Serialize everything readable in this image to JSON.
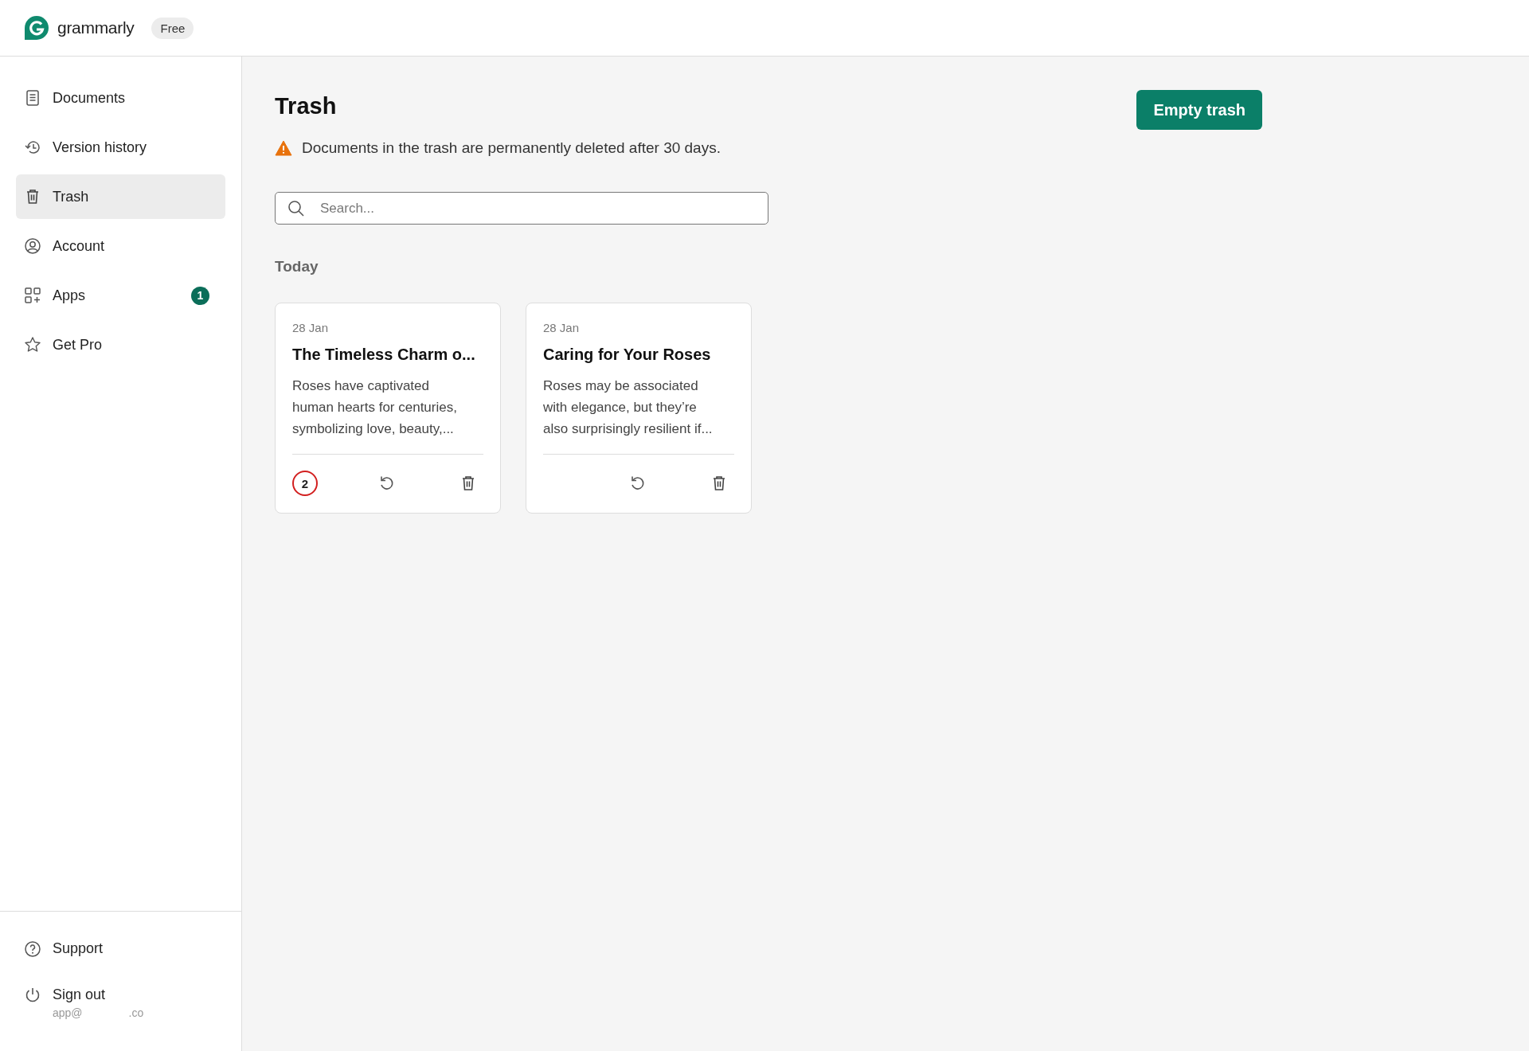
{
  "header": {
    "logo_text": "grammarly",
    "plan_badge": "Free"
  },
  "sidebar": {
    "items": [
      {
        "kind": "documents",
        "label": "Documents",
        "selected": false
      },
      {
        "kind": "history",
        "label": "Version history",
        "selected": false
      },
      {
        "kind": "trash",
        "label": "Trash",
        "selected": true
      },
      {
        "kind": "account",
        "label": "Account",
        "selected": false
      },
      {
        "kind": "apps",
        "label": "Apps",
        "selected": false,
        "badge": "1"
      },
      {
        "kind": "star",
        "label": "Get Pro",
        "selected": false
      }
    ],
    "bottom_items": [
      {
        "kind": "support",
        "label": "Support"
      },
      {
        "kind": "power",
        "label": "Sign out",
        "email_start": "app@",
        "email_end": ".co"
      }
    ]
  },
  "main": {
    "title": "Trash",
    "empty_button": "Empty trash",
    "notice": "Documents in the trash are permanently deleted after 30 days.",
    "search": {
      "placeholder": "Search..."
    },
    "group_label": "Today",
    "cards": [
      {
        "date": "28 Jan",
        "title": "The Timeless Charm o...",
        "excerpt": "Roses have captivated human hearts for centuries, symbolizing love, beauty,...",
        "issue_count": "2"
      },
      {
        "date": "28 Jan",
        "title": "Caring for Your Roses",
        "excerpt": "Roses may be associated with elegance, but they’re also surprisingly resilient if..."
      }
    ]
  }
}
